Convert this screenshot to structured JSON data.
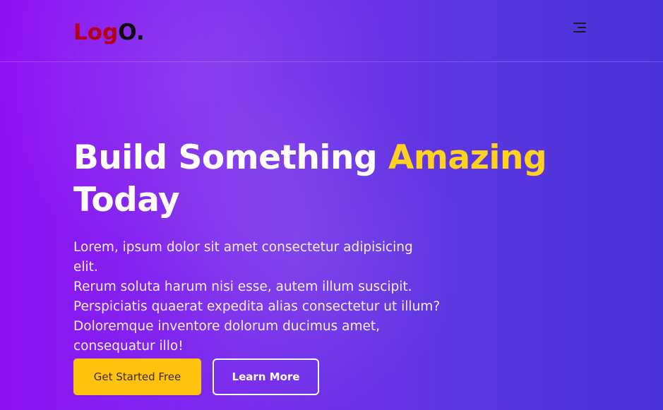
{
  "header": {
    "logo_part1": "Log",
    "logo_part2": "O.",
    "menu_icon": "hamburger-menu-icon"
  },
  "hero": {
    "title_part1": "Build Something ",
    "title_accent": "Amazing",
    "title_part2": "Today",
    "description_lines": [
      "Lorem, ipsum dolor sit amet consectetur adipisicing elit.",
      "Rerum soluta harum nisi esse, autem illum suscipit.",
      "Perspiciatis quaerat expedita alias consectetur ut illum?",
      "Doloremque inventore dolorum ducimus amet,",
      "consequatur illo!"
    ],
    "primary_button": "Get Started Free",
    "secondary_button": "Learn More"
  },
  "colors": {
    "accent": "#ffd21f",
    "primary_button": "#ffc30f",
    "logo_red": "#b50016",
    "background_start": "#8f12f4",
    "background_end": "#4a33d8"
  }
}
